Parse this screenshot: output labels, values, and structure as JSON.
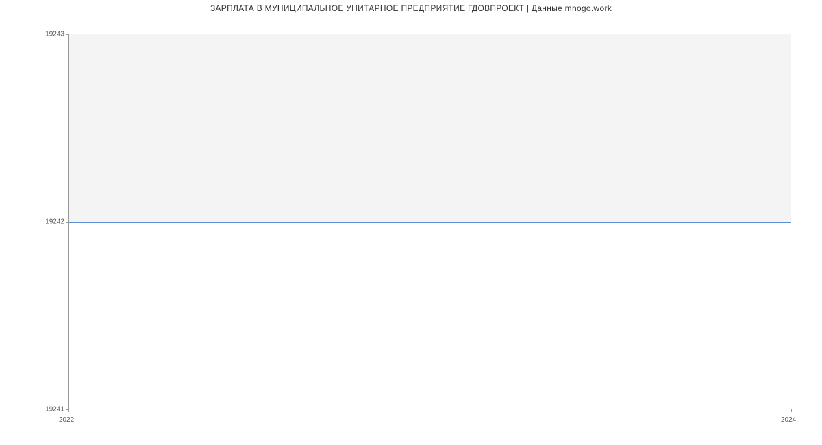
{
  "chart_data": {
    "type": "line",
    "title": "ЗАРПЛАТА В МУНИЦИПАЛЬНОЕ УНИТАРНОЕ ПРЕДПРИЯТИЕ ГДОВПРОЕКТ | Данные mnogo.work",
    "x": [
      2022,
      2024
    ],
    "values": [
      19242,
      19242
    ],
    "xlabel": "",
    "ylabel": "",
    "x_ticks": [
      "2022",
      "2024"
    ],
    "y_ticks": [
      "19241",
      "19242",
      "19243"
    ],
    "ylim": [
      19241,
      19243
    ],
    "xlim": [
      2022,
      2024
    ]
  }
}
